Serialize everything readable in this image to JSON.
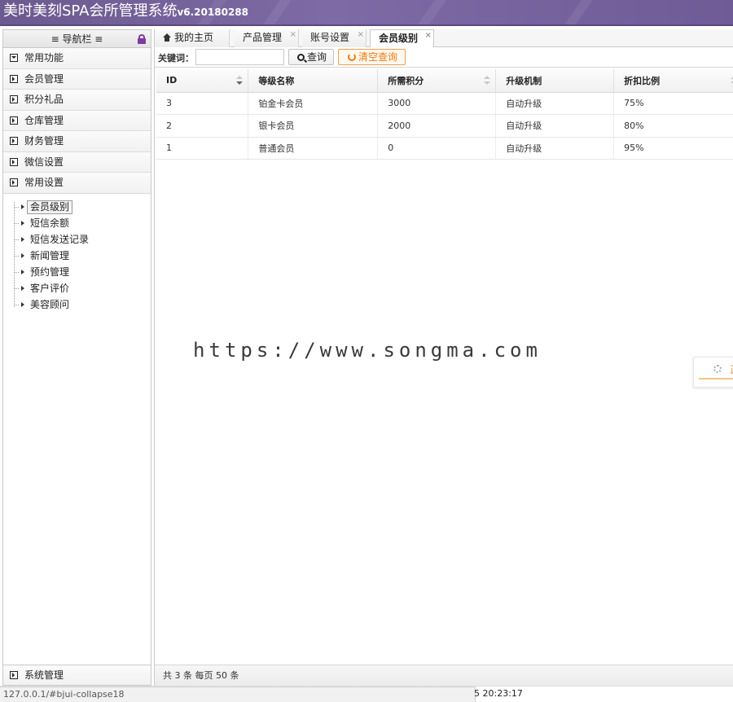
{
  "header": {
    "title": "美时美刻SPA会所管理系统",
    "version": "v6.20180288"
  },
  "sidebar": {
    "nav_title": "≡ 导航栏 ≡",
    "sections": [
      {
        "label": "常用功能",
        "state": "expanded"
      },
      {
        "label": "会员管理",
        "state": "collapsed"
      },
      {
        "label": "积分礼品",
        "state": "collapsed"
      },
      {
        "label": "仓库管理",
        "state": "collapsed"
      },
      {
        "label": "财务管理",
        "state": "collapsed"
      },
      {
        "label": "微信设置",
        "state": "collapsed"
      },
      {
        "label": "常用设置",
        "state": "collapsed"
      }
    ],
    "tree_items": [
      "会员级别",
      "短信余额",
      "短信发送记录",
      "新闻管理",
      "预约管理",
      "客户评价",
      "美容顾问"
    ],
    "active_tree_item": "会员级别",
    "bottom_section": "系统管理"
  },
  "tabs": [
    {
      "label": "我的主页",
      "closable": false,
      "active": false
    },
    {
      "label": "产品管理",
      "closable": true,
      "active": false
    },
    {
      "label": "账号设置",
      "closable": true,
      "active": false
    },
    {
      "label": "会员级别",
      "closable": true,
      "active": true
    }
  ],
  "toolbar": {
    "keyword_label": "关键词：",
    "keyword_value": "",
    "search_label": "查询",
    "clear_label": "清空查询"
  },
  "table": {
    "columns": [
      "ID",
      "等级名称",
      "所需积分",
      "升级机制",
      "折扣比例"
    ],
    "rows": [
      [
        "3",
        "铂金卡会员",
        "3000",
        "自动升级",
        "75%"
      ],
      [
        "2",
        "银卡会员",
        "2000",
        "自动升级",
        "80%"
      ],
      [
        "1",
        "普通会员",
        "0",
        "自动升级",
        "95%"
      ]
    ]
  },
  "footer": {
    "summary": "共 3 条 每页 50 条"
  },
  "side_widget": {
    "text": "正"
  },
  "watermark": "https://www.songma.com",
  "statusbar": {
    "url": "127.0.0.1/#bjui-collapse18",
    "clock": "5 20:23:17"
  },
  "colors": {
    "header": "#7e6aa5",
    "accent_orange": "#f07a10",
    "lock": "#7e3aa0"
  }
}
